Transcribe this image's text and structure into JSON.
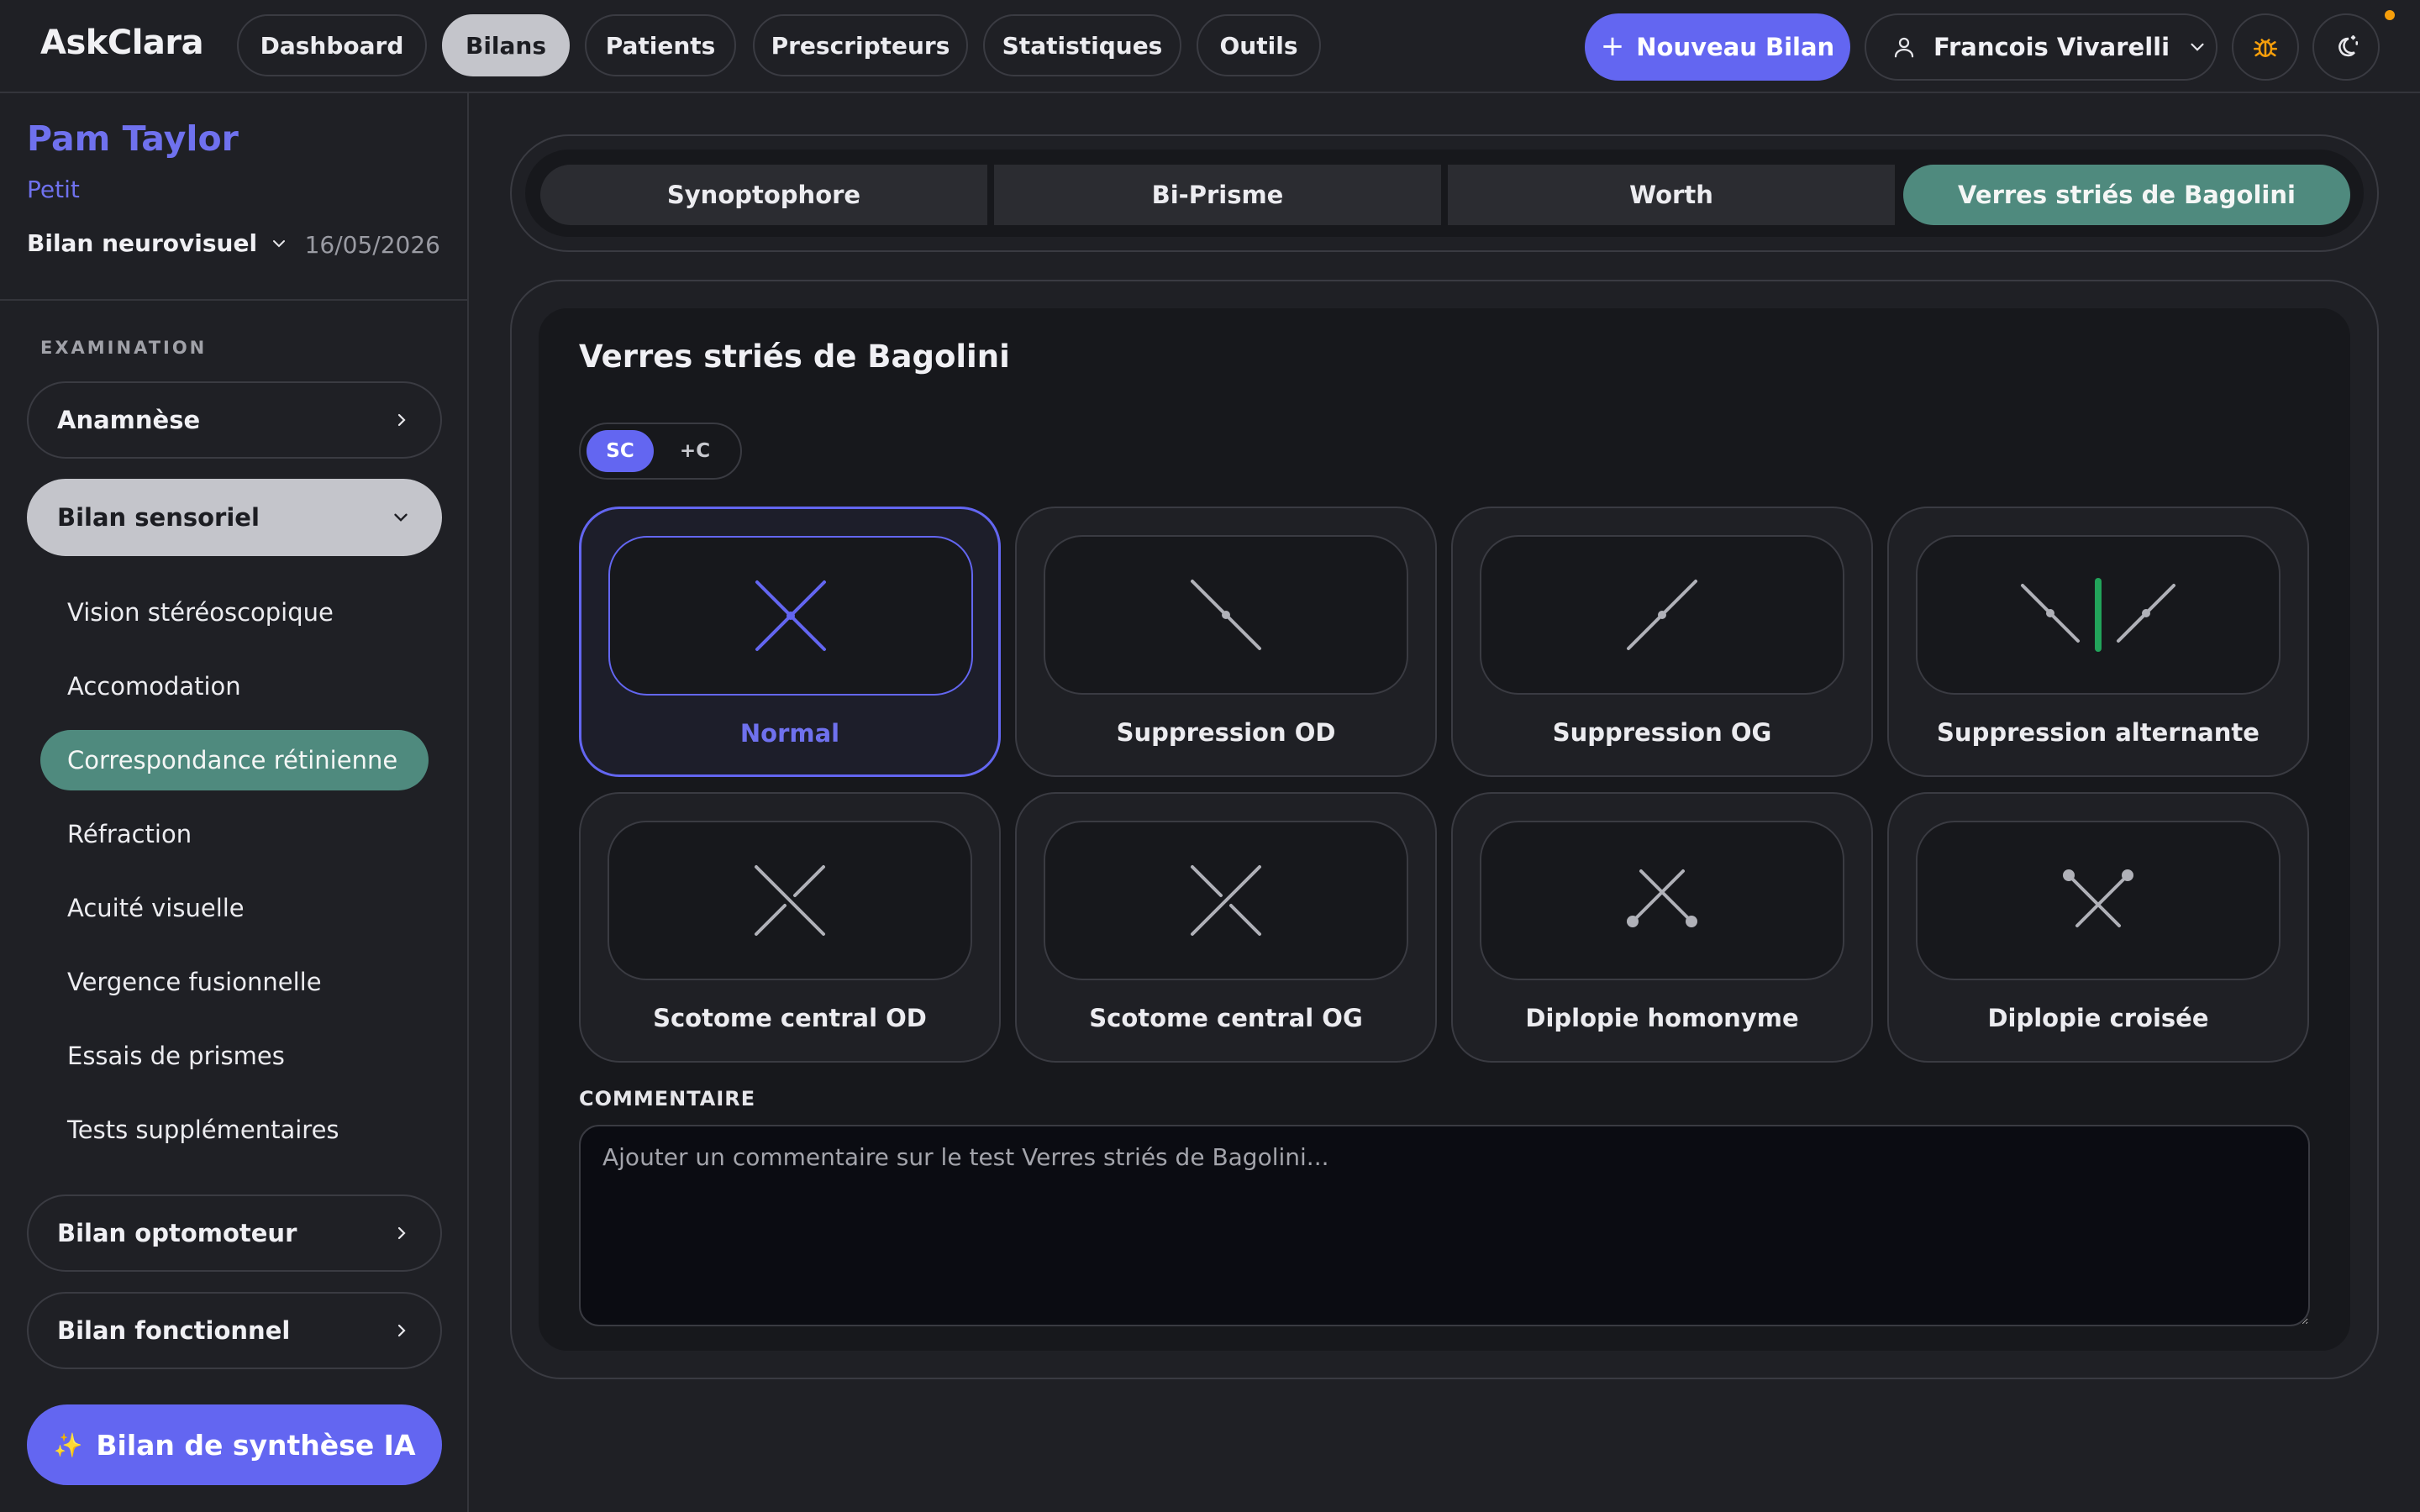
{
  "app": {
    "title": "AskClara"
  },
  "nav": {
    "items": [
      {
        "label": "Dashboard",
        "active": false
      },
      {
        "label": "Bilans",
        "active": true
      },
      {
        "label": "Patients",
        "active": false
      },
      {
        "label": "Prescripteurs",
        "active": false
      },
      {
        "label": "Statistiques",
        "active": false
      },
      {
        "label": "Outils",
        "active": false
      }
    ],
    "new_button": "Nouveau Bilan",
    "user_name": "Francois Vivarelli",
    "icons": [
      "plus-icon",
      "user-icon",
      "chevron-down-icon",
      "bug-icon",
      "theme-toggle-icon"
    ],
    "accent_color": "#6366f1",
    "notification_color": "#f59e0b"
  },
  "sidebar": {
    "patient_name": "Pam Taylor",
    "patient_sub": "Petit",
    "bilan_type": "Bilan neurovisuel",
    "bilan_date": "16/05/2026",
    "section_label": "EXAMINATION",
    "groups": [
      {
        "label": "Anamnèse",
        "open": false
      },
      {
        "label": "Bilan sensoriel",
        "open": true
      },
      {
        "label": "Bilan optomoteur",
        "open": false
      },
      {
        "label": "Bilan fonctionnel",
        "open": false
      }
    ],
    "items": [
      {
        "label": "Vision stéréoscopique",
        "active": false
      },
      {
        "label": "Accomodation",
        "active": false
      },
      {
        "label": "Correspondance rétinienne",
        "active": true
      },
      {
        "label": "Réfraction",
        "active": false
      },
      {
        "label": "Acuité visuelle",
        "active": false
      },
      {
        "label": "Vergence fusionnelle",
        "active": false
      },
      {
        "label": "Essais de prismes",
        "active": false
      },
      {
        "label": "Tests supplémentaires",
        "active": false
      }
    ],
    "ai_button": "Bilan de synthèse IA",
    "ai_icon": "✨",
    "active_color": "#4f8a7e"
  },
  "main": {
    "tabs": [
      {
        "label": "Synoptophore",
        "active": false
      },
      {
        "label": "Bi-Prisme",
        "active": false
      },
      {
        "label": "Worth",
        "active": false
      },
      {
        "label": "Verres striés de Bagolini",
        "active": true
      }
    ],
    "panel_title": "Verres striés de Bagolini",
    "correction_toggle": [
      {
        "label": "SC",
        "active": true
      },
      {
        "label": "+C",
        "active": false
      }
    ],
    "options": [
      {
        "label": "Normal",
        "icon": "bagolini-normal-icon",
        "selected": true
      },
      {
        "label": "Suppression OD",
        "icon": "bagolini-suppression-od-icon",
        "selected": false
      },
      {
        "label": "Suppression OG",
        "icon": "bagolini-suppression-og-icon",
        "selected": false
      },
      {
        "label": "Suppression alternante",
        "icon": "bagolini-suppression-alternante-icon",
        "selected": false
      },
      {
        "label": "Scotome central OD",
        "icon": "bagolini-scotome-od-icon",
        "selected": false
      },
      {
        "label": "Scotome central OG",
        "icon": "bagolini-scotome-og-icon",
        "selected": false
      },
      {
        "label": "Diplopie homonyme",
        "icon": "bagolini-diplopie-homonyme-icon",
        "selected": false
      },
      {
        "label": "Diplopie croisée",
        "icon": "bagolini-diplopie-croisee-icon",
        "selected": false
      }
    ],
    "comment_label": "COMMENTAIRE",
    "comment_value": "",
    "comment_placeholder": "Ajouter un commentaire sur le test Verres striés de Bagolini...",
    "alternante_bar_color": "#22a35a"
  }
}
